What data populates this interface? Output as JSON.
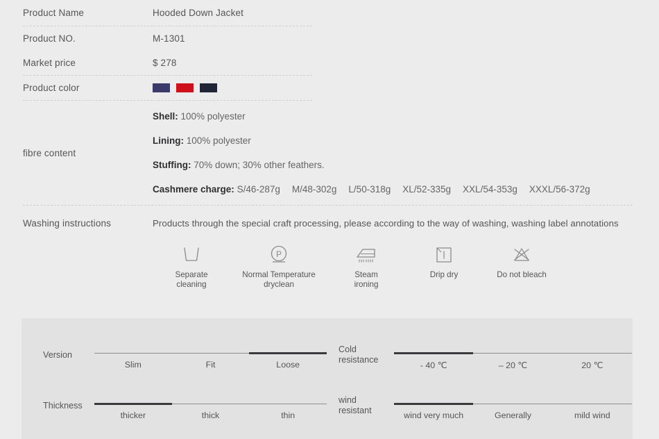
{
  "rows": {
    "product_name": {
      "label": "Product  Name",
      "value": "Hooded  Down Jacket"
    },
    "product_no": {
      "label": "Product NO.",
      "value": "M-1301"
    },
    "market_price": {
      "label": "Market price",
      "value": "$ 278"
    },
    "product_color": {
      "label": "Product color",
      "swatches": [
        {
          "name": "navy-blue",
          "hex": "#3a3b6b"
        },
        {
          "name": "red",
          "hex": "#cd1019"
        },
        {
          "name": "dark-navy",
          "hex": "#222536"
        }
      ]
    }
  },
  "fibre": {
    "label": "fibre content",
    "lines": [
      {
        "key": "Shell:",
        "value": "100% polyester"
      },
      {
        "key": "Lining:",
        "value": "100% polyester"
      },
      {
        "key": "Stuffing:",
        "value": "70% down; 30% other feathers."
      }
    ],
    "cashmere_key": "Cashmere charge:",
    "cashmere_sizes": [
      "S/46-287g",
      "M/48-302g",
      "L/50-318g",
      "XL/52-335g",
      "XXL/54-353g",
      "XXXL/56-372g"
    ]
  },
  "washing": {
    "label": "Washing instructions",
    "text": "Products through the special craft processing, please according to the way of washing, washing label annotations",
    "icons": [
      {
        "icon": "wash-tub-icon",
        "label": "Separate\ncleaning",
        "line1": "Separate",
        "line2": "cleaning"
      },
      {
        "icon": "dryclean-p-icon",
        "label": "Normal Temperature dryclean",
        "line1": "Normal Temperature",
        "line2": "dryclean"
      },
      {
        "icon": "steam-iron-icon",
        "label": "Steam ironing",
        "line1": "Steam",
        "line2": "ironing"
      },
      {
        "icon": "drip-dry-icon",
        "label": "Drip dry",
        "line1": "Drip dry",
        "line2": ""
      },
      {
        "icon": "do-not-bleach-icon",
        "label": "Do not bleach",
        "line1": "Do not bleach",
        "line2": ""
      }
    ]
  },
  "attributes": [
    {
      "name": "Version",
      "name_line1": "Version",
      "name_line2": "",
      "options": [
        "Slim",
        "Fit",
        "Loose"
      ],
      "selected_index": 2
    },
    {
      "name": "Cold resistance",
      "name_line1": "Cold",
      "name_line2": "resistance",
      "options": [
        "- 40 ℃",
        "– 20 ℃",
        "20 ℃"
      ],
      "selected_index": 0
    },
    {
      "name": "Thickness",
      "name_line1": "Thickness",
      "name_line2": "",
      "options": [
        "thicker",
        "thick",
        "thin"
      ],
      "selected_index": 0
    },
    {
      "name": "wind resistant",
      "name_line1": "wind",
      "name_line2": "resistant",
      "options": [
        "wind very much",
        "Generally",
        "mild wind"
      ],
      "selected_index": 0
    }
  ]
}
